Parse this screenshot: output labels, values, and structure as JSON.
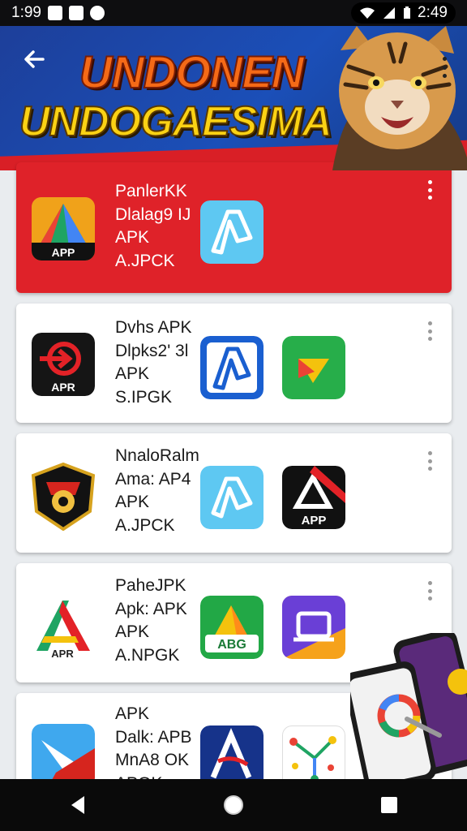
{
  "status_bar": {
    "time_left": "1:99",
    "time_right": "2:49"
  },
  "header": {
    "title_line1": "UNDONEN",
    "title_line2": "UNDOGAESIMA",
    "back_icon": "arrow-left-icon",
    "more_icon": "more-vert-icon"
  },
  "cards": [
    {
      "lines": [
        "PanlerKK",
        "Dlalag9 IJ",
        "APK",
        "A.JPCK"
      ],
      "highlight": true,
      "icons": [
        "google-drive-apk-icon",
        "blue-ribbon-icon"
      ]
    },
    {
      "lines": [
        "Dvhs APK",
        "Dlpks2' 3l",
        "APK",
        "S.IPGK"
      ],
      "highlight": false,
      "icons": [
        "red-arrow-apr-icon",
        "blue-ribbon-box-icon",
        "green-play-icon"
      ]
    },
    {
      "lines": [
        "NnaloRalm",
        "Ama: AP4",
        "APK",
        "A.JPCK"
      ],
      "highlight": false,
      "icons": [
        "shield-crest-icon",
        "light-blue-ribbon-icon",
        "black-app-a-icon"
      ]
    },
    {
      "lines": [
        "PaheJPK",
        "Apk: APK",
        "APK",
        "A.NPGK"
      ],
      "highlight": false,
      "icons": [
        "tri-color-a-icon",
        "green-abc-icon",
        "purple-monitor-icon"
      ]
    },
    {
      "lines": [
        "APK",
        "Dalk: APB",
        "MnA8 OK",
        "APGK"
      ],
      "highlight": false,
      "icons": [
        "blue-plane-icon",
        "navy-a-icon",
        "colorful-tree-icon"
      ]
    }
  ],
  "icon_text": {
    "apk_badge": "APP",
    "apr_badge": "APR",
    "app_badge": "APP",
    "apr2_badge": "APR",
    "abc_badge": "ABG"
  },
  "nav": {
    "back": "back-triangle-icon",
    "home": "home-circle-icon",
    "recents": "recents-square-icon"
  }
}
